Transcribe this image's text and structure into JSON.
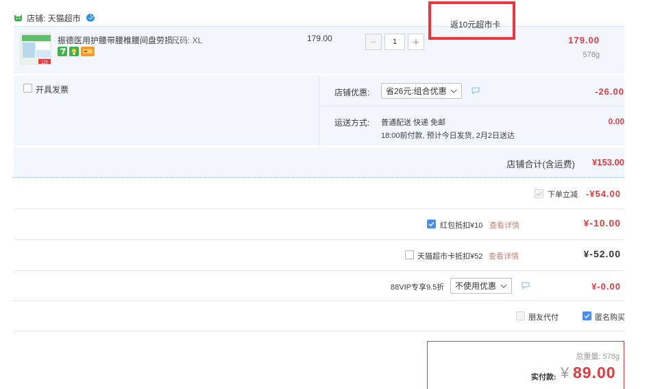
{
  "shop": {
    "label": "店铺: 天猫超市"
  },
  "item": {
    "title": "振德医用护腰带腰椎腰间盘劳损...",
    "sku": "尺码: XL",
    "unit_price": "179.00",
    "quantity": "1",
    "rebate": "返10元超市卡",
    "total": "179.00",
    "weight": "578g",
    "thumb_badge": "125"
  },
  "invoice": {
    "label": "开具发票"
  },
  "promo": {
    "label": "店铺优惠:",
    "selected": "省26元:组合优惠",
    "amount": "-26.00"
  },
  "shipping": {
    "label": "运送方式:",
    "line1": "普通配送 快递 免邮",
    "line2": "18:00前付款, 预计今日发货, 2月2日送达",
    "amount": "0.00"
  },
  "shop_total": {
    "label": "店铺合计(含运费)",
    "amount": "¥153.00"
  },
  "discounts": {
    "instant": {
      "label": "下单立减",
      "amount": "-¥54.00"
    },
    "redpacket": {
      "label": "红包抵扣¥10",
      "link": "查看详情",
      "amount": "¥-10.00"
    },
    "tmcard": {
      "label": "天猫超市卡抵扣¥52",
      "link": "查看详情",
      "amount": "¥-52.00"
    },
    "vip": {
      "label": "88VIP专享9.5折",
      "selected": "不使用优惠",
      "amount": "¥-0.00"
    }
  },
  "options": {
    "friend_pay": "朋友代付",
    "anonymous": "匿名购买"
  },
  "summary": {
    "weight": "总重量: 578g",
    "pay_label": "实付款:",
    "currency": "¥",
    "amount": "89.00"
  },
  "colors": {
    "accent_red": "#e4393c",
    "highlight_box": "#f0353a",
    "checkbox_blue": "#4a8cf0",
    "row_bg": "#f2f7fd"
  },
  "icons": [
    "tmall-cat-icon",
    "wangwang-icon",
    "seven-day-return-icon",
    "service-icon",
    "card-icon",
    "chevron-down-icon",
    "chat-icon",
    "check-icon"
  ]
}
